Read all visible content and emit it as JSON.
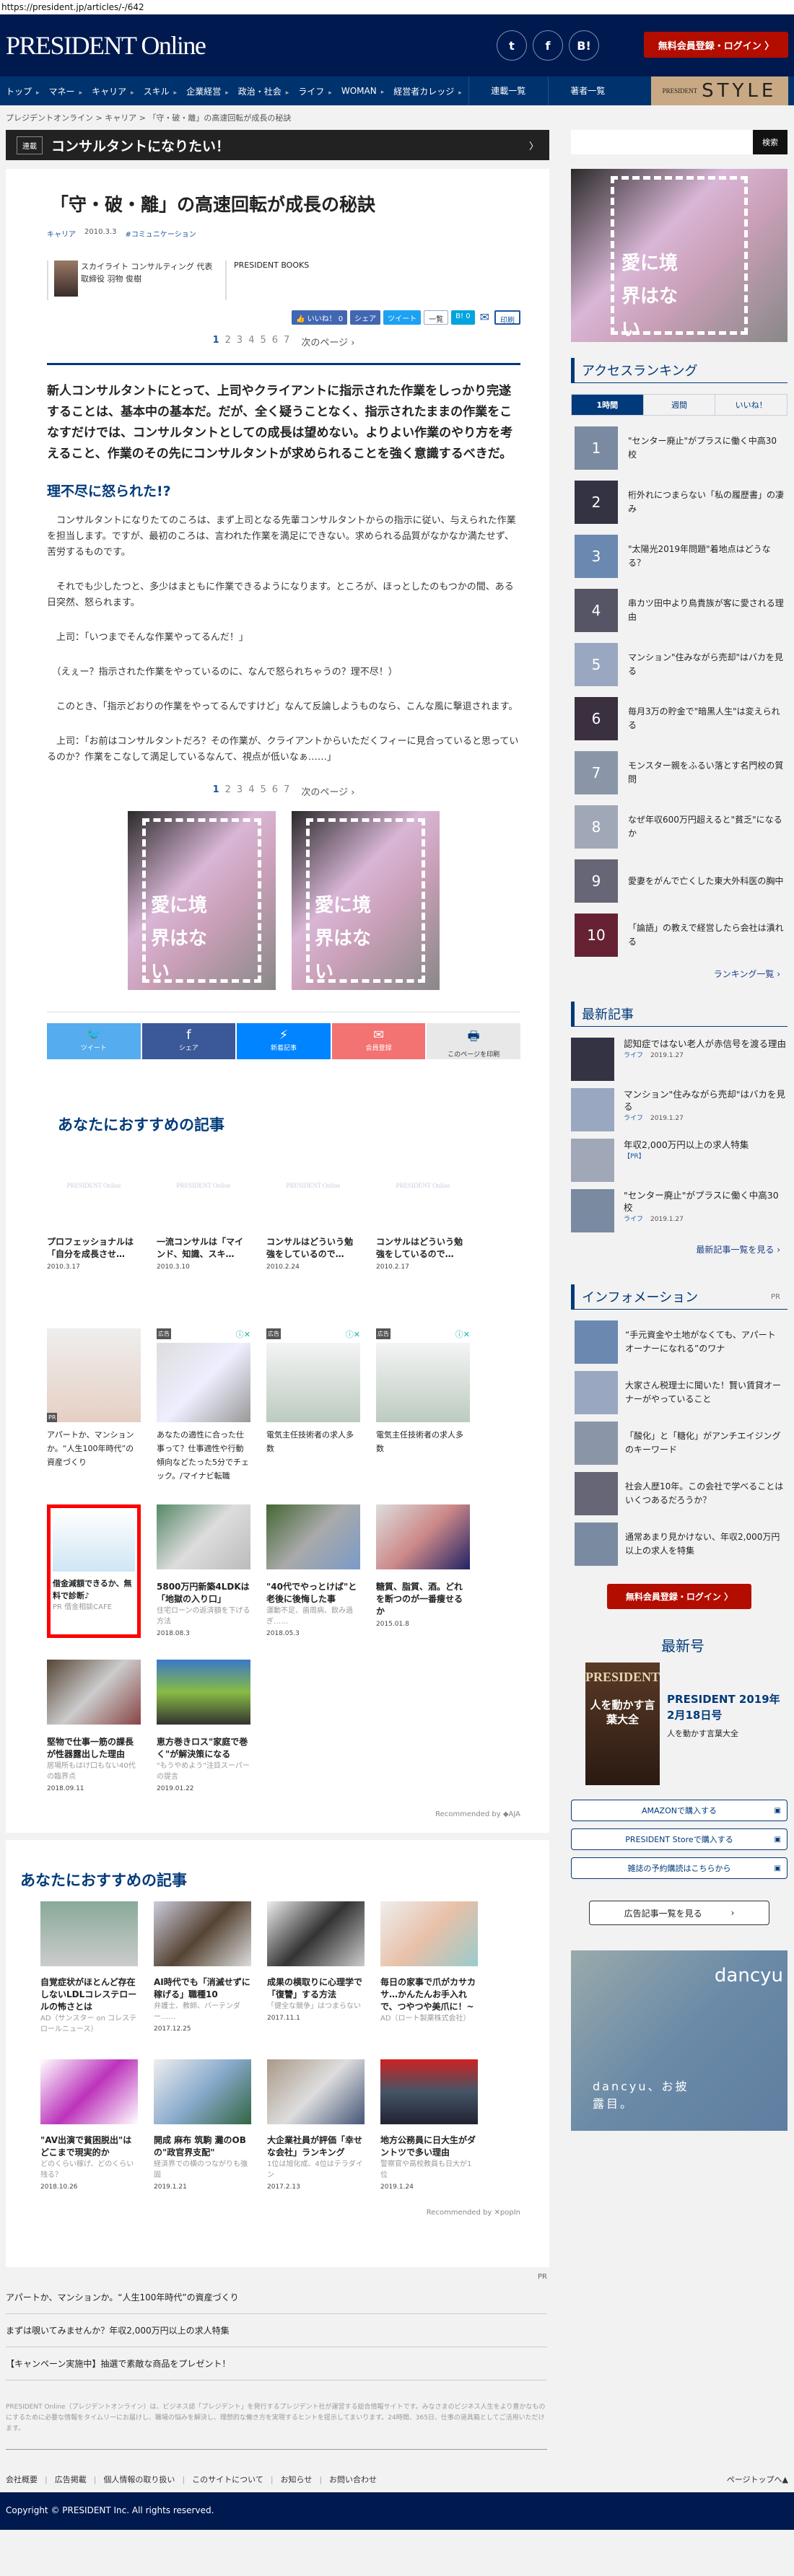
{
  "url": "https://president.jp/articles/-/642",
  "header": {
    "logo": "PRESIDENT Online",
    "social": [
      "twitter",
      "facebook",
      "B!"
    ],
    "register": "無料会員登録・ログイン 〉"
  },
  "nav": {
    "items": [
      "トップ",
      "マネー",
      "キャリア",
      "スキル",
      "企業経営",
      "政治・社会",
      "ライフ",
      "WOMAN",
      "経営者カレッジ"
    ],
    "serial": "連載一覧",
    "authors": "著者一覧",
    "style_small": "PRESIDENT",
    "style_big": "STYLE"
  },
  "breadcrumb": [
    "プレジデントオンライン",
    "キャリア",
    "「守・破・離」の高速回転が成長の秘訣"
  ],
  "series": {
    "tag": "連載",
    "title": "コンサルタントになりたい！",
    "chevron": "〉"
  },
  "article": {
    "title": "「守・破・離」の高速回転が成長の秘訣",
    "category": "キャリア",
    "date": "2010.3.3",
    "hashtag": "#コミュニケーション",
    "author": "スカイライト コンサルティング 代表取締役 羽物 俊樹",
    "source": "PRESIDENT BOOKS",
    "share": {
      "like": "👍 いいね！ 0",
      "share": "シェア",
      "tweet": "ツイート",
      "list": "一覧",
      "hatena": "B! 0",
      "mail": "✉",
      "print": "印刷"
    },
    "pages": [
      "1",
      "2",
      "3",
      "4",
      "5",
      "6",
      "7"
    ],
    "next": "次のページ ›",
    "lead": "新人コンサルタントにとって、上司やクライアントに指示された作業をしっかり完遂することは、基本中の基本だ。だが、全く疑うことなく、指示されたままの作業をこなすだけでは、コンサルタントとしての成長は望めない。よりよい作業のやり方を考えること、作業のその先にコンサルタントが求められることを強く意識するべきだ。",
    "subheading": "理不尽に怒られた!?",
    "paragraphs": [
      "　コンサルタントになりたてのころは、まず上司となる先輩コンサルタントからの指示に従い、与えられた作業を担当します。ですが、最初のころは、言われた作業を満足にできない。求められる品質がなかなか満たせず、苦労するものです。",
      "　それでも少したつと、多少はまともに作業できるようになります。ところが、ほっとしたのもつかの間、ある日突然、怒られます。",
      "　上司：「いつまでそんな作業やってるんだ！」",
      "　（えぇー？指示された作業をやっているのに、なんで怒られちゃうの？理不尽！）",
      "　このとき、「指示どおりの作業をやってるんですけど」なんて反論しようものなら、こんな風に撃退されます。",
      "　上司：「お前はコンサルタントだろ？その作業が、クライアントからいただくフィーに見合っていると思っているのか？作業をこなして満足しているなんて、視点が低いなぁ……」"
    ]
  },
  "ad_text": "愛に境界はない",
  "share_bar": [
    {
      "icon": "twitter",
      "label": "ツイート",
      "color": "#55acee"
    },
    {
      "icon": "facebook",
      "label": "シェア",
      "color": "#3b5998"
    },
    {
      "icon": "messenger",
      "label": "新着記事",
      "color": "#0084ff"
    },
    {
      "icon": "mail",
      "label": "会員登録",
      "color": "#f37272"
    },
    {
      "icon": "print",
      "label": "このページを印刷",
      "color": "#e8e8e8"
    }
  ],
  "recommend": {
    "heading": "あなたにおすすめの記事",
    "placeholder_logo": "PRESIDENT Online",
    "related": [
      {
        "title": "プロフェッショナルは「自分を成長させ…",
        "date": "2010.3.17"
      },
      {
        "title": "一流コンサルは「マインド、知識、スキ…",
        "date": "2010.3.10"
      },
      {
        "title": "コンサルはどういう勉強をしているので…",
        "date": "2010.2.24"
      },
      {
        "title": "コンサルはどういう勉強をしているので…",
        "date": "2010.2.17"
      }
    ],
    "ads": [
      {
        "tag": "PR",
        "title": "アパートか、マンションか。“人生100年時代”の資産づくり"
      },
      {
        "tag": "広告",
        "title": "あなたの適性に合った仕事って？仕事適性や行動傾向などたった5分でチェック。/マイナビ転職"
      },
      {
        "tag": "広告",
        "title": "電気主任技術者の求人多数"
      },
      {
        "tag": "広告",
        "title": "電気主任技術者の求人多数"
      }
    ],
    "ad_close": "ⓘ✕",
    "row3": [
      {
        "title": "借金減額できるか、無料で診断♪",
        "sub": "PR 借金相談CAFE",
        "date": ""
      },
      {
        "title": "5800万円新築4LDKは「地獄の入り口」",
        "sub": "住宅ローンの返済額を下げる方法",
        "date": "2018.08.3"
      },
      {
        "title": "\"40代でやっとけば\"と老後に後悔した事",
        "sub": "運動不足、歯周病、飲み過ぎ……",
        "date": "2018.05.3"
      },
      {
        "title": "糖質、脂質、酒。どれを断つのが一番痩せるか",
        "sub": "",
        "date": "2015.01.8"
      }
    ],
    "row4": [
      {
        "title": "堅物で仕事一筋の課長が性器露出した理由",
        "sub": "居場所もはけ口もない40代の臨界点",
        "date": "2018.09.11"
      },
      {
        "title": "恵方巻きロス\"家庭で巻く\"が解決策になる",
        "sub": "\"もうやめよう\"注目スーパーの提言",
        "date": "2019.01.22"
      }
    ],
    "recommended_by": "Recommended by ◆AJA"
  },
  "recommend2": {
    "heading": "あなたにおすすめの記事",
    "items": [
      {
        "title": "自覚症状がほとんど存在しないLDLコレステロールの怖さとは",
        "sub": "AD（サンスター on コレステロールニュース）",
        "date": ""
      },
      {
        "title": "AI時代でも「消滅せずに稼げる」職種10",
        "sub": "弁護士、教師、バーテンダー……",
        "date": "2017.12.25"
      },
      {
        "title": "成果の横取りに心理学で「復讐」する方法",
        "sub": "「健全な競争」はつまらない",
        "date": "2017.11.1"
      },
      {
        "title": "毎日の家事で爪がカサカサ…かんたんお手入れで、つやつや美爪に！~",
        "sub": "AD（ロート製薬株式会社）",
        "date": ""
      },
      {
        "title": "\"AV出演で貧困脱出\"はどこまで現実的か",
        "sub": "どのくらい稼げ、どのくらい残る？",
        "date": "2018.10.26"
      },
      {
        "title": "開成 麻布 筑駒 灘のOBの\"政官界支配\"",
        "sub": "経済界での横のつながりも強固",
        "date": "2019.1.21"
      },
      {
        "title": "大企業社員が評価「幸せな会社」ランキング",
        "sub": "1位は旭化成、4位はテラダイン",
        "date": "2017.2.13"
      },
      {
        "title": "地方公務員に日大生がダントツで多い理由",
        "sub": "警察官や高校教員も日大が1位",
        "date": "2019.1.24"
      }
    ],
    "recommended_by": "Recommended by ✕popIn"
  },
  "footer": {
    "pr": "PR",
    "links": [
      "アパートか、マンションか。“人生100年時代”の資産づくり",
      "まずは覗いてみませんか？年収2,000万円以上の求人特集",
      "【キャンペーン実施中】抽選で素敵な商品をプレゼント！"
    ],
    "about": "PRESIDENT Online（プレジデントオンライン）は、ビジネス誌「プレジデント」を発行するプレジデント社が運営する総合情報サイトです。みなさまのビジネス人生をより豊かなものにするために必要な情報をタイムリーにお届けし、職場の悩みを解決し、理想的な働き方を実現するヒントを提示してまいります。24時間、365日、仕事の道具箱としてご活用いただけます。",
    "nav": [
      "会社概要",
      "広告掲載",
      "個人情報の取り扱い",
      "このサイトについて",
      "お知らせ",
      "お問い合わせ"
    ],
    "pagetop": "ページトップへ▲",
    "copyright": "Copyright © PRESIDENT Inc. All rights reserved."
  },
  "sidebar": {
    "search_button": "検索",
    "ranking": {
      "heading": "アクセスランキング",
      "tabs": [
        "1時間",
        "週間",
        "いいね！"
      ],
      "items": [
        {
          "rank": "1",
          "title": "\"センター廃止\"がプラスに働く中高30校"
        },
        {
          "rank": "2",
          "title": "桁外れにつまらない「私の履歴書」の凄み"
        },
        {
          "rank": "3",
          "title": "\"太陽光2019年問題\"着地点はどうなる？"
        },
        {
          "rank": "4",
          "title": "串カツ田中より鳥貴族が客に愛される理由"
        },
        {
          "rank": "5",
          "title": "マンション\"住みながら売却\"はバカを見る"
        },
        {
          "rank": "6",
          "title": "毎月3万の貯金で\"暗黒人生\"は変えられる"
        },
        {
          "rank": "7",
          "title": "モンスター親をふるい落とす名門校の質問"
        },
        {
          "rank": "8",
          "title": "なぜ年収600万円超えると\"貧乏\"になるか"
        },
        {
          "rank": "9",
          "title": "愛妻をがんで亡くした東大外科医の胸中"
        },
        {
          "rank": "10",
          "title": "「論語」の教えで経営したら会社は潰れる"
        }
      ],
      "more": "ランキング一覧 ›"
    },
    "latest": {
      "heading": "最新記事",
      "items": [
        {
          "title": "認知症ではない老人が赤信号を渡る理由",
          "cat": "ライフ",
          "date": "2019.1.27"
        },
        {
          "title": "マンション\"住みながら売却\"はバカを見る",
          "cat": "ライフ",
          "date": "2019.1.27"
        },
        {
          "title": "年収2,000万円以上の求人特集",
          "cat": "【PR】",
          "date": ""
        },
        {
          "title": "\"センター廃止\"がプラスに働く中高30校",
          "cat": "ライフ",
          "date": "2019.1.27"
        }
      ],
      "more": "最新記事一覧を見る ›"
    },
    "info": {
      "heading": "インフォメーション",
      "pr": "PR",
      "items": [
        "“手元資金や土地がなくても、アパートオーナーになれる”のワナ",
        "大家さん税理士に聞いた！賢い賃貸オーナーがやっていること",
        "「酸化」と「糖化」がアンチエイジングのキーワード",
        "社会人歴10年。この会社で学べることはいくつあるだろうか？",
        "通常あまり見かけない、年収2,000万円以上の求人を特集"
      ]
    },
    "register": "無料会員登録・ログイン 〉",
    "issue": {
      "heading": "最新号",
      "cover_logo": "PRESIDENT",
      "cover_copy": "人を動かす言葉大全",
      "name": "PRESIDENT 2019年2月18日号",
      "subtitle": "人を動かす言葉大全",
      "buttons": [
        "AMAZONで購入する",
        "PRESIDENT Storeで購入する",
        "雑誌の予約購読はこちらから"
      ]
    },
    "ad_list": "広告記事一覧を見る",
    "dancyu": {
      "logo": "dancyu",
      "copy": "dancyu、お披露目。"
    }
  }
}
